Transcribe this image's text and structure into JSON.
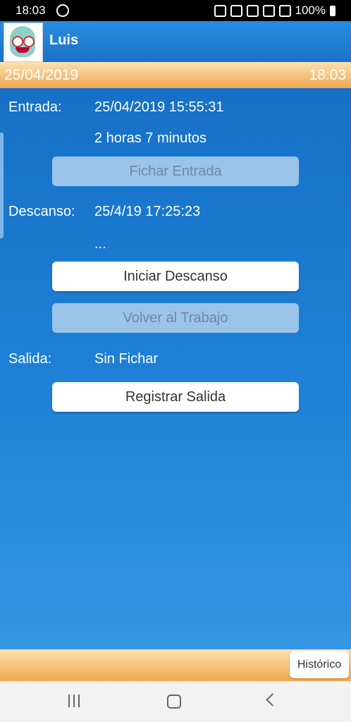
{
  "status_bar": {
    "time": "18:03",
    "battery": "100%"
  },
  "header": {
    "user_name": "Luis"
  },
  "date_bar": {
    "date": "25/04/2019",
    "time": "18:03"
  },
  "entrada": {
    "label": "Entrada:",
    "timestamp": "25/04/2019 15:55:31",
    "duration": "2 horas 7 minutos",
    "button": "Fichar Entrada"
  },
  "descanso": {
    "label": "Descanso:",
    "timestamp": "25/4/19 17:25:23",
    "duration": "...",
    "start_button": "Iniciar Descanso",
    "return_button": "Volver al Trabajo"
  },
  "salida": {
    "label": "Salida:",
    "status": "Sin Fichar",
    "button": "Registrar Salida"
  },
  "footer": {
    "history_button": "Histórico"
  },
  "icons": [
    "whatsapp-icon",
    "alarm-icon",
    "bluetooth-icon",
    "location-icon",
    "wifi-icon",
    "signal-icon",
    "battery-icon",
    "recent-apps-icon",
    "home-icon",
    "back-icon"
  ]
}
